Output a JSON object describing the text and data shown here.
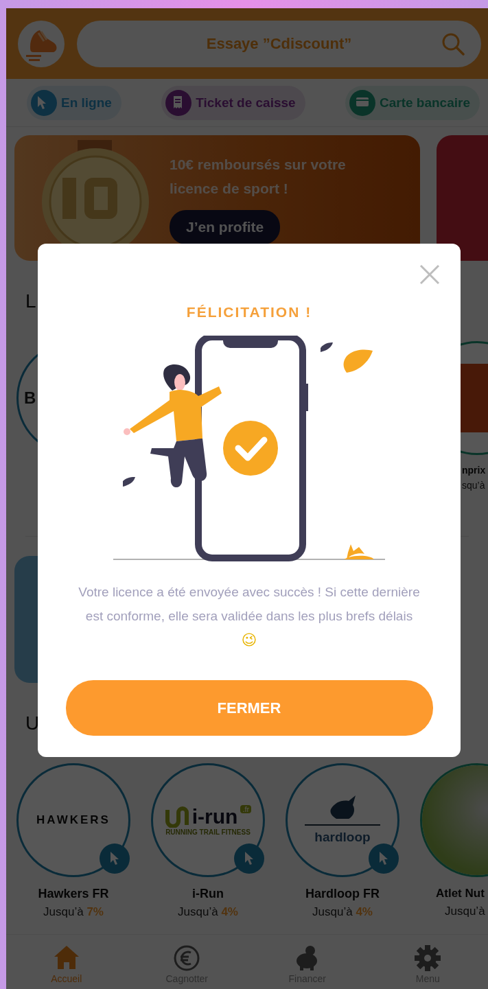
{
  "header": {
    "search_placeholder": "Essaye ”Cdiscount”"
  },
  "filters": [
    {
      "label": "En ligne"
    },
    {
      "label": "Ticket de caisse"
    },
    {
      "label": "Carte bancaire"
    }
  ],
  "banner": {
    "title": "10€ remboursés sur votre licence de sport !",
    "button": "J’en profite"
  },
  "section_1": {
    "title": "L",
    "left_logo_text": "B",
    "right_store_name": "nprix",
    "right_store_rate": "squ’à"
  },
  "section_2": {
    "title": "U",
    "stores": [
      {
        "kind": "online",
        "logo_text": "HAWKERS",
        "name": "Hawkers FR",
        "rate_prefix": "Jusqu’à",
        "rate": "7%"
      },
      {
        "kind": "online",
        "logo_text": "i-run",
        "logo_badge": ".fr",
        "logo_tagline": "RUNNING TRAIL FITNESS",
        "name": "i-Run",
        "rate_prefix": "Jusqu’à",
        "rate": "4%"
      },
      {
        "kind": "online",
        "logo_text": "hardloop",
        "name": "Hardloop FR",
        "rate_prefix": "Jusqu’à",
        "rate": "4%"
      },
      {
        "kind": "photo",
        "name": "Atlet Nut",
        "rate_prefix": "Jusqu’à"
      }
    ]
  },
  "nav": [
    {
      "label": "Accueil",
      "selected": true
    },
    {
      "label": "Cagnotter",
      "selected": false
    },
    {
      "label": "Financer",
      "selected": false
    },
    {
      "label": "Menu",
      "selected": false
    }
  ],
  "modal": {
    "title": "FÉLICITATION !",
    "message": "Votre licence a été envoyée avec succès ! Si cette dernière est conforme, elle sera validée dans les plus brefs délais",
    "emoji": "😉",
    "button": "FERMER"
  }
}
